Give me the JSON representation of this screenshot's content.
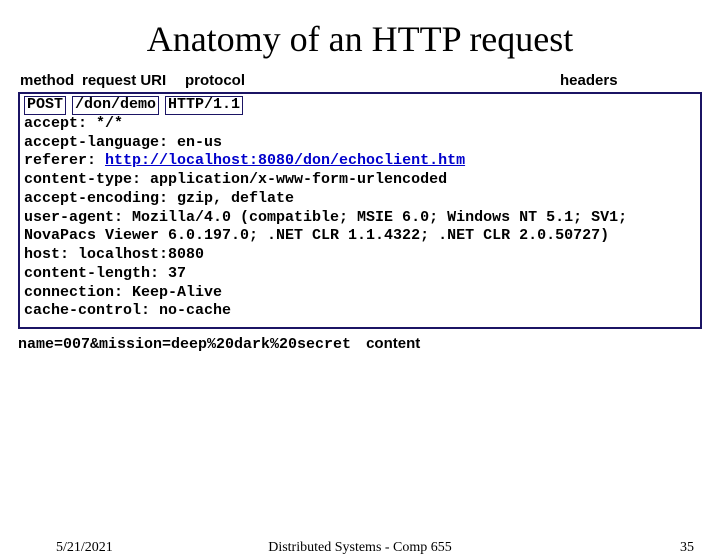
{
  "title": "Anatomy of an HTTP request",
  "labels": {
    "method": "method",
    "uri": "request URI",
    "protocol": "protocol",
    "headers": "headers",
    "content": "content"
  },
  "request": {
    "method": "POST",
    "uri": "/don/demo",
    "protocol": "HTTP/1.1"
  },
  "headers": {
    "accept": "accept: */*",
    "accept_language": "accept-language: en-us",
    "referer_key": "referer: ",
    "referer_url": "http://localhost:8080/don/echoclient.htm",
    "content_type": "content-type: application/x-www-form-urlencoded",
    "accept_encoding": "accept-encoding: gzip, deflate",
    "user_agent": "user-agent: Mozilla/4.0 (compatible; MSIE 6.0; Windows NT 5.1; SV1; NovaPacs Viewer 6.0.197.0; .NET CLR 1.1.4322; .NET CLR 2.0.50727)",
    "host": "host: localhost:8080",
    "content_length": "content-length: 37",
    "connection": "connection: Keep-Alive",
    "cache_control": "cache-control: no-cache"
  },
  "body": "name=007&mission=deep%20dark%20secret",
  "footer": {
    "date": "5/21/2021",
    "course": "Distributed Systems - Comp 655",
    "page": "35"
  }
}
